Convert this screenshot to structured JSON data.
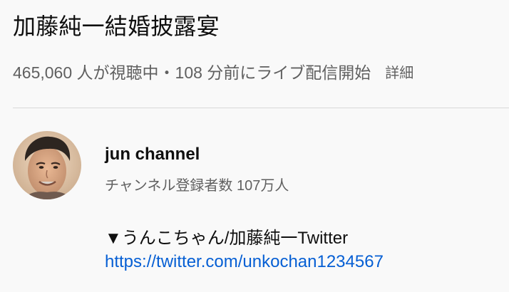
{
  "video": {
    "title": "加藤純一結婚披露宴",
    "meta": "465,060 人が視聴中・108 分前にライブ配信開始",
    "details_label": "詳細"
  },
  "channel": {
    "name": "jun channel",
    "subscribers": "チャンネル登録者数 107万人",
    "avatar_icon": "channel-avatar"
  },
  "description": {
    "line": "▼うんこちゃん/加藤純一Twitter",
    "link_text": "https://twitter.com/unkochan1234567"
  },
  "colors": {
    "background": "#f9f9f9",
    "primary_text": "#0f0f0f",
    "secondary_text": "#606060",
    "link": "#065fd4",
    "divider": "#d9d9d9"
  }
}
